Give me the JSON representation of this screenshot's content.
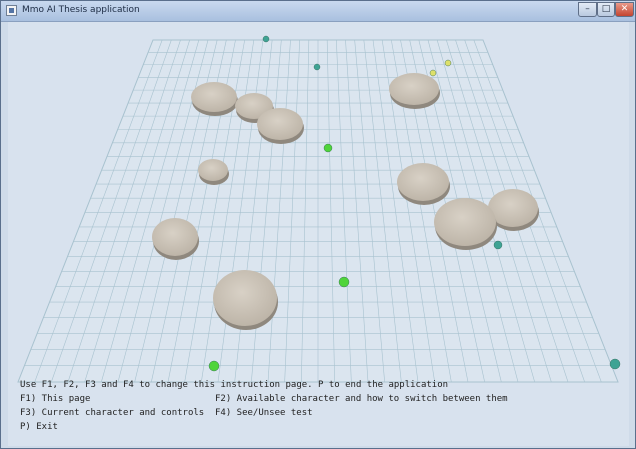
{
  "window": {
    "title": "Mmo AI Thesis application",
    "buttons": {
      "minimize": "–",
      "maximize": "□",
      "close": "✕"
    }
  },
  "scene": {
    "floor_color": "#dbe5ef",
    "grid_color": "#a8c2cf",
    "obstacle_color": "#ccc4b9",
    "agent_colors": {
      "green": "#4fd43a",
      "teal": "#3fa394",
      "yellow": "#dde06a"
    }
  },
  "instructions": {
    "line1": "Use F1, F2, F3 and F4 to change this instruction page. P to end the application",
    "f1": "F1) This page",
    "f2": "F2) Available character and how to switch between them",
    "f3": "F3) Current character and controls",
    "f4": "F4) See/Unsee test",
    "p": "P) Exit"
  }
}
